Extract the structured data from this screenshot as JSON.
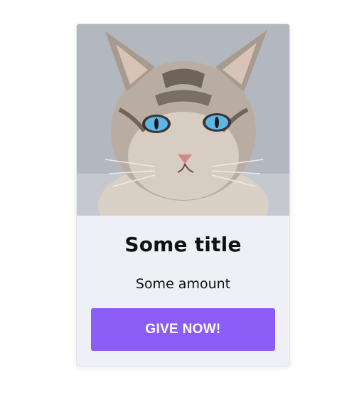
{
  "card": {
    "title": "Some title",
    "amount": "Some amount",
    "button_label": "GIVE NOW!",
    "image": "cat-photo",
    "accent_color": "#8b5cf6",
    "card_bg": "#eef0f5"
  }
}
